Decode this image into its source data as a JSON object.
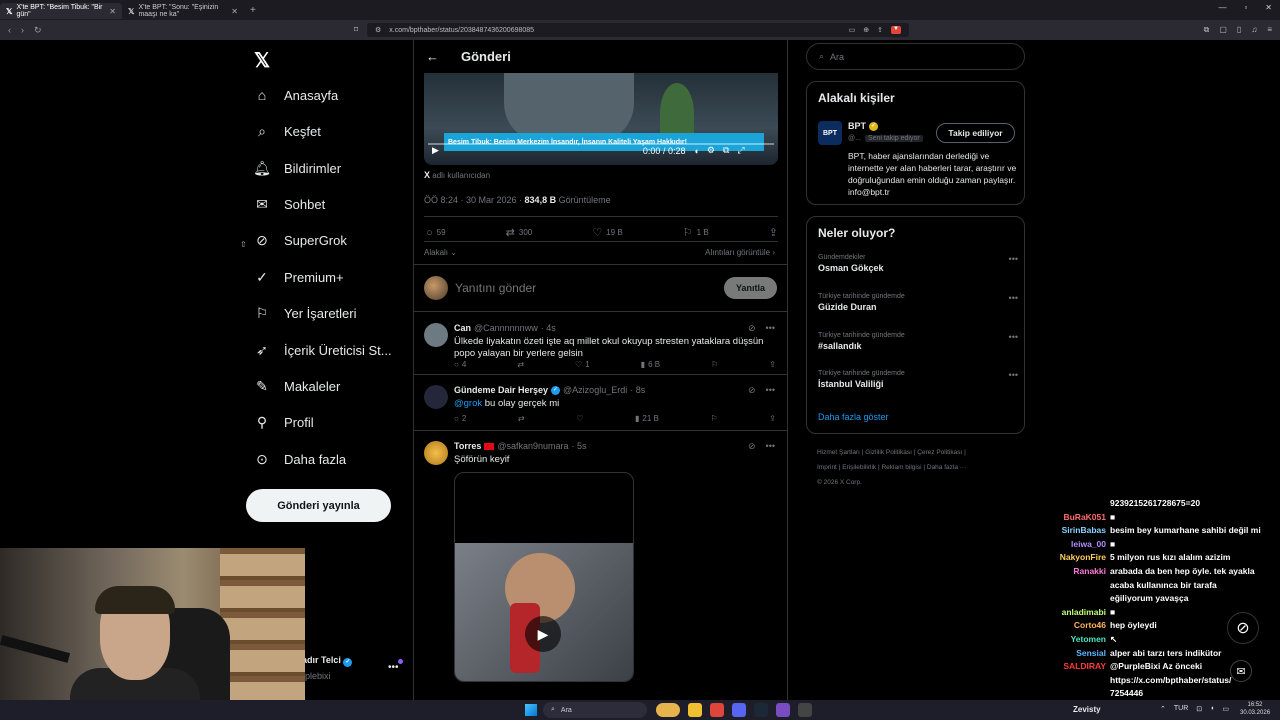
{
  "browser": {
    "tabs": [
      {
        "title": "X'te BPT: \"Besim Tibuk: \"Bir gün\"",
        "active": true
      },
      {
        "title": "X'te BPT: \"Sonu: \"Eşinizin maaşı ne ka\"",
        "active": false
      }
    ],
    "url": "x.com/bpthaber/status/2038487436200698085"
  },
  "sidebar": {
    "nav": [
      {
        "label": "Anasayfa",
        "icon": "home-icon"
      },
      {
        "label": "Keşfet",
        "icon": "search-icon"
      },
      {
        "label": "Bildirimler",
        "icon": "bell-icon"
      },
      {
        "label": "Sohbet",
        "icon": "mail-icon"
      },
      {
        "label": "SuperGrok",
        "icon": "grok-icon"
      },
      {
        "label": "Premium+",
        "icon": "verified-icon"
      },
      {
        "label": "Yer İşaretleri",
        "icon": "bookmark-icon"
      },
      {
        "label": "İçerik Üreticisi St...",
        "icon": "rocket-icon"
      },
      {
        "label": "Makaleler",
        "icon": "article-icon"
      },
      {
        "label": "Profil",
        "icon": "person-icon"
      },
      {
        "label": "Daha fazla",
        "icon": "more-icon"
      }
    ],
    "post_button": "Gönderi yayınla",
    "profile_name": "adır Telci",
    "profile_handle": "rplebixi"
  },
  "main": {
    "header_title": "Gönderi",
    "video": {
      "caption": "Besim Tibuk: Benim Merkezim İnsandır, İnsanın Kaliteli Yaşam Hakkıdır!",
      "time": "0:00 / 0:28"
    },
    "x_user_prefix": "X",
    "x_user_suffix": "adlı kullanıcıdan",
    "meta_time": "ÖÖ 8:24 · 30 Mar 2026 · ",
    "meta_views": "834,8 B",
    "meta_views_label": " Görüntüleme",
    "stats": {
      "replies": "59",
      "reposts": "300",
      "likes": "19 B",
      "bookmarks": "1 B"
    },
    "relevance": "Alakalı",
    "quotes_link": "Alıntıları görüntüle",
    "reply_placeholder": "Yanıtını gönder",
    "reply_button": "Yanıtla",
    "tweets": [
      {
        "name": "Can",
        "handle": "@Cannnnnnww",
        "time": "· 4s",
        "text": "Ülkede liyakatın özeti işte aq millet okul okuyup stresten yataklara düşsün popo yalayan bir yerlere gelsin",
        "replies": "4",
        "reposts": "",
        "likes": "1",
        "views": "6 B"
      },
      {
        "name": "Gündeme Dair Herşey",
        "handle": "@Azizoglu_Erdi",
        "time": "· 8s",
        "mention": "@grok",
        "text": " bu olay gerçek mi",
        "replies": "2",
        "reposts": "",
        "likes": "",
        "views": "21 B"
      },
      {
        "name": "Torres",
        "handle": "@safkan9numara",
        "time": "· 5s",
        "text": "Şöförün keyif"
      }
    ]
  },
  "right": {
    "search_placeholder": "Ara",
    "related_title": "Alakalı kişiler",
    "bpt": {
      "name": "BPT",
      "handle": "@...",
      "follows_you": "Seni takip ediyor",
      "following_btn": "Takip ediliyor",
      "bio": "BPT, haber ajanslarından derlediği ve internette yer alan haberleri tarar, araştırır ve doğruluğundan emin olduğu zaman paylaşır. info@bpt.tr"
    },
    "trends_title": "Neler oluyor?",
    "trends": [
      {
        "category": "Gündemdekiler",
        "name": "Osman Gökçek"
      },
      {
        "category": "Türkiye tarihinde gündemde",
        "name": "Güzide Duran"
      },
      {
        "category": "Türkiye tarihinde gündemde",
        "name": "#sallandık"
      },
      {
        "category": "Türkiye tarihinde gündemde",
        "name": "İstanbul Valiliği"
      }
    ],
    "show_more": "Daha fazla göster",
    "footer": [
      "Hizmet Şartları",
      "Gizlilik Politikası",
      "Çerez Politikası",
      "Imprint",
      "Erişilebilirlik",
      "Reklam bilgisi",
      "Daha fazla ···",
      "© 2026 X Corp."
    ]
  },
  "chat": [
    {
      "user": "",
      "msg": "9239215261728675=20",
      "color": "#ffffff"
    },
    {
      "user": "BuRaK051",
      "msg": "■",
      "color": "#ff6b6b"
    },
    {
      "user": "SirinBabas",
      "msg": "besim bey kumarhane sahibi değil mi",
      "color": "#8ad3ff"
    },
    {
      "user": "leiwa_00",
      "msg": "■",
      "color": "#b58cff"
    },
    {
      "user": "NakyonFire",
      "msg": "5 milyon rus kızı alalım azizim",
      "color": "#ffcf5c"
    },
    {
      "user": "Ranakki",
      "msg": "arabada da ben hep öyle. tek ayakla",
      "color": "#ff7ad9"
    },
    {
      "user": "",
      "msg": "acaba kullanınca bir tarafa",
      "color": "#ffffff"
    },
    {
      "user": "",
      "msg": "eğiliyorum yavaşça",
      "color": "#ffffff"
    },
    {
      "user": "anladimabi",
      "msg": "■",
      "color": "#c4ff7a"
    },
    {
      "user": "Corto46",
      "msg": "hep öyleydi",
      "color": "#ffb35c"
    },
    {
      "user": "Yetomen",
      "msg": "↖",
      "color": "#4fe3c1"
    },
    {
      "user": "Sensial",
      "msg": "alper abi tarzı ters indikütor",
      "color": "#5cb8ff"
    },
    {
      "user": "SALDIRAY",
      "msg": "@PurpleBixi Az önceki",
      "color": "#ff3b3b"
    },
    {
      "user": "",
      "msg": "https://x.com/bpthaber/status/",
      "color": "#ffffff"
    },
    {
      "user": "",
      "msg": "7254446",
      "color": "#ffffff"
    }
  ],
  "taskbar": {
    "search": "Ara",
    "user": "Zevisty",
    "lang": "TUR",
    "time": "16:52",
    "date": "30.03.2026"
  }
}
